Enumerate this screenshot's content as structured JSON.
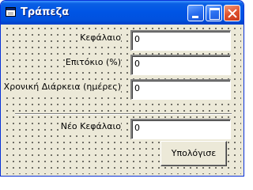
{
  "window": {
    "title": "Τράπεζα"
  },
  "form": {
    "capital_label": "Κεφάλαιο",
    "capital_value": "0",
    "rate_label": "Επιτόκιο (%)",
    "rate_value": "0",
    "duration_label": "Χρονική Διάρκεια (ημέρες)",
    "duration_value": "0",
    "new_capital_label": "Νέο Κεφάλαιο",
    "new_capital_value": "0",
    "calculate_button": "Υπολόγισε"
  },
  "colors": {
    "titlebar": "#0055e5",
    "window_bg": "#ece9d8",
    "close_button": "#e0522e"
  }
}
